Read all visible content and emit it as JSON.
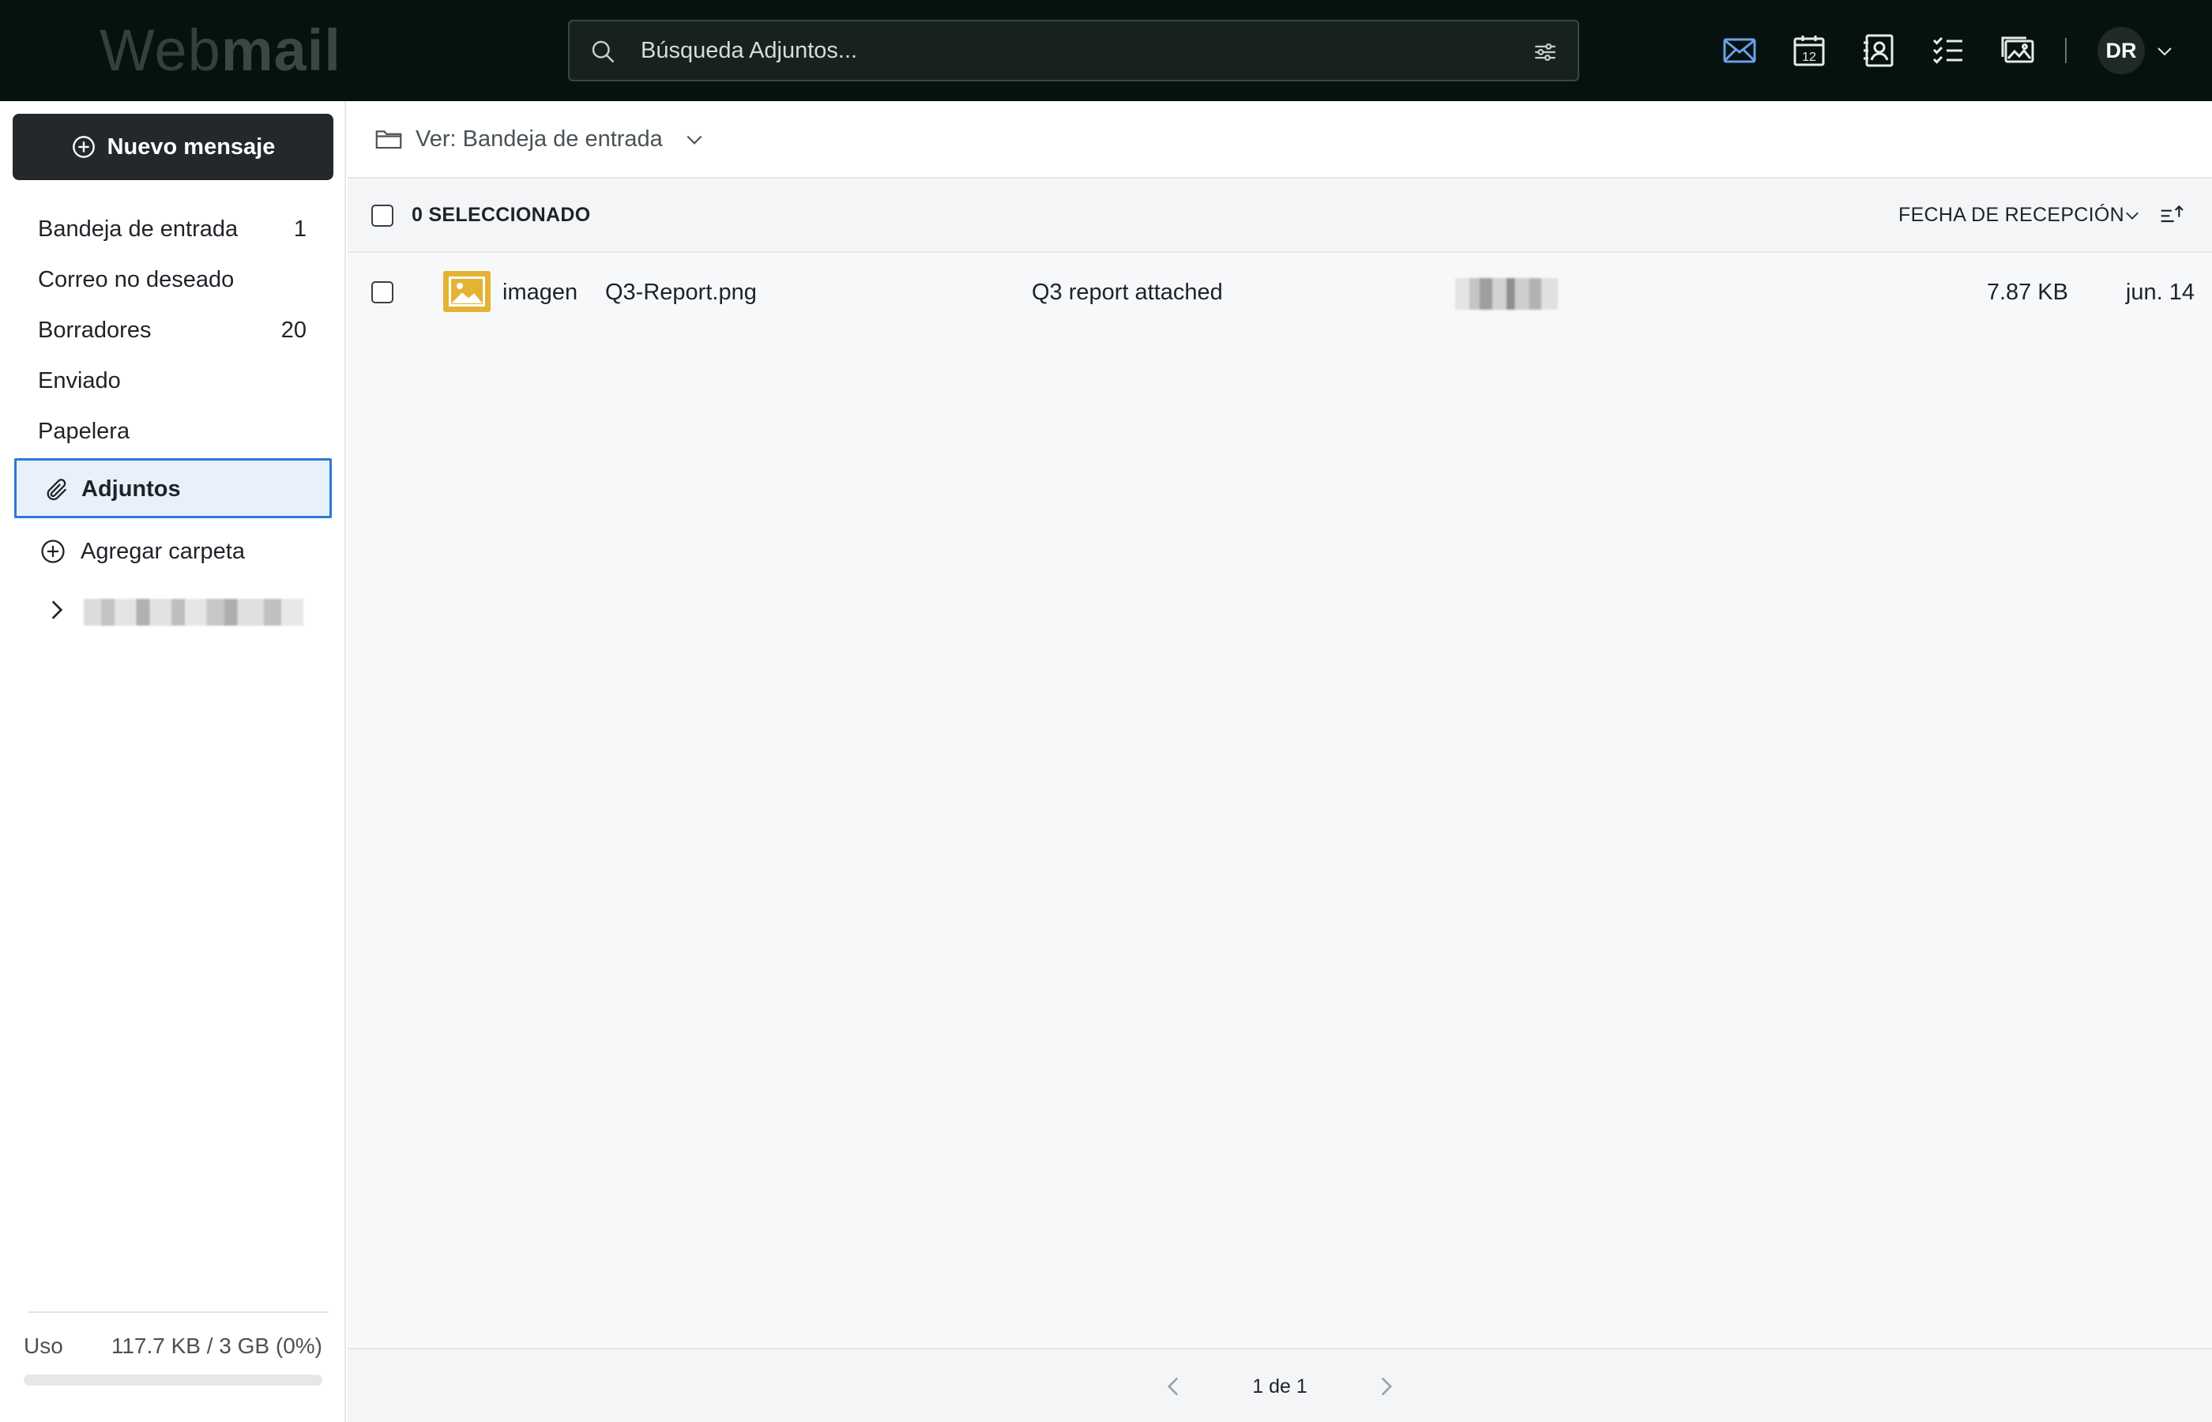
{
  "header": {
    "logo_light": "Web",
    "logo_bold": "mail",
    "search_placeholder": "Búsqueda Adjuntos...",
    "avatar_initials": "DR",
    "apps": [
      "mail-icon",
      "calendar-icon",
      "contacts-icon",
      "tasks-icon",
      "photos-icon"
    ],
    "calendar_day": "12",
    "active_app_color": "#6f9ee8"
  },
  "sidebar": {
    "compose_label": "Nuevo mensaje",
    "folders": [
      {
        "label": "Bandeja de entrada",
        "count": "1"
      },
      {
        "label": "Correo no deseado",
        "count": ""
      },
      {
        "label": "Borradores",
        "count": "20"
      },
      {
        "label": "Enviado",
        "count": ""
      },
      {
        "label": "Papelera",
        "count": ""
      }
    ],
    "active_item": "Adjuntos",
    "add_folder_label": "Agregar carpeta",
    "storage": {
      "label": "Uso",
      "value": "117.7 KB / 3 GB (0%)",
      "fraction": 0
    }
  },
  "main": {
    "view_label": "Ver: Bandeja de entrada",
    "selected_label": "0 SELECCIONADO",
    "sort_label": "FECHA DE RECEPCIÓN",
    "rows": [
      {
        "type": "imagen",
        "filename": "Q3-Report.png",
        "subject": "Q3 report attached",
        "size": "7.87 KB",
        "date": "jun. 14"
      }
    ],
    "pagination": "1 de 1"
  },
  "colors": {
    "header_bg": "#061210",
    "accent": "#2b7bd6",
    "active_item_bg": "#e8f1fb",
    "image_icon": "#e4b335",
    "compose_bg": "#23292b"
  }
}
